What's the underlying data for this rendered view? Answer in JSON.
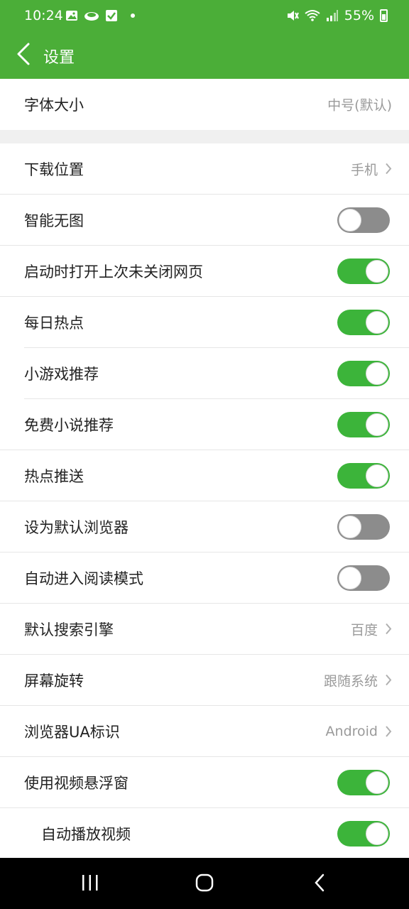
{
  "status_bar": {
    "time": "10:24",
    "battery": "55%",
    "icons": [
      "image-icon",
      "cloud-icon",
      "check-icon",
      "dot-icon",
      "mute-icon",
      "wifi-icon",
      "signal-icon",
      "battery-icon"
    ]
  },
  "header": {
    "title": "设置",
    "back_icon": "chevron-left-icon",
    "background": "#4bae38"
  },
  "settings": {
    "font_size": {
      "label": "字体大小",
      "value": "中号(默认)"
    },
    "download_location": {
      "label": "下载位置",
      "value": "手机"
    },
    "smart_no_image": {
      "label": "智能无图",
      "on": false
    },
    "restore_tabs": {
      "label": "启动时打开上次未关闭网页",
      "on": true
    },
    "daily_hot": {
      "label": "每日热点",
      "on": true
    },
    "mini_games": {
      "label": "小游戏推荐",
      "on": true
    },
    "free_novels": {
      "label": "免费小说推荐",
      "on": true
    },
    "hot_push": {
      "label": "热点推送",
      "on": true
    },
    "default_browser": {
      "label": "设为默认浏览器",
      "on": false
    },
    "reading_mode": {
      "label": "自动进入阅读模式",
      "on": false
    },
    "search_engine": {
      "label": "默认搜索引擎",
      "value": "百度"
    },
    "screen_rotation": {
      "label": "屏幕旋转",
      "value": "跟随系统"
    },
    "ua": {
      "label": "浏览器UA标识",
      "value": "Android"
    },
    "video_float": {
      "label": "使用视频悬浮窗",
      "on": true
    },
    "autoplay_video": {
      "label": "自动播放视频",
      "on": true
    }
  },
  "colors": {
    "accent": "#3cb43a",
    "toggle_off": "#8c8c8c",
    "value_text": "#9a9a9a"
  },
  "system_nav": [
    "recent-apps-icon",
    "home-icon",
    "back-icon"
  ]
}
